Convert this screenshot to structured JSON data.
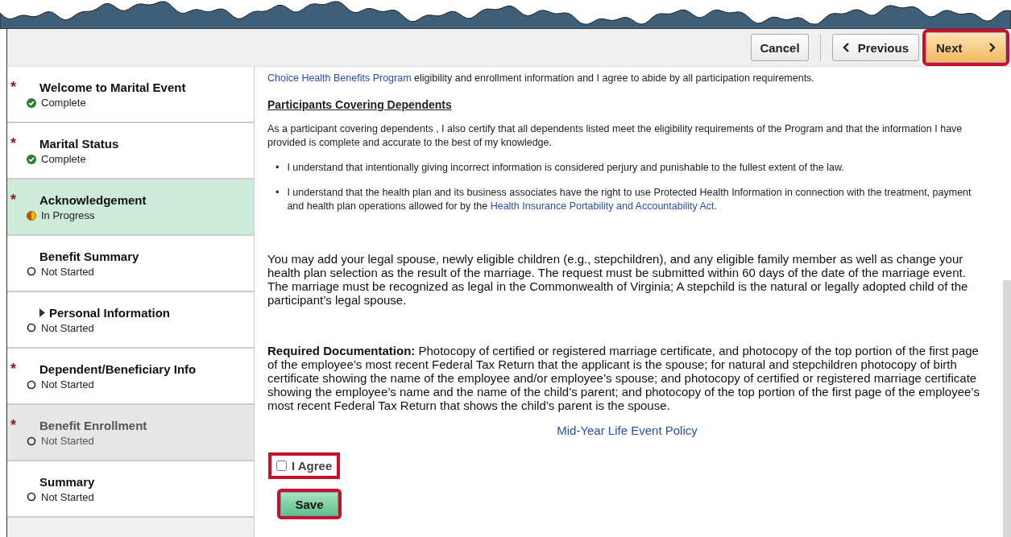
{
  "toolbar": {
    "buttons": [
      {
        "label": "Cancel",
        "kind": "cancel",
        "highlighted": false
      },
      {
        "label": "Previous",
        "kind": "previous",
        "highlighted": false
      },
      {
        "label": "Next",
        "kind": "next",
        "highlighted": true
      }
    ]
  },
  "steps": [
    {
      "required_mark": "*",
      "title": "Welcome to Marital Event",
      "status": {
        "text": "Complete",
        "kind": "complete"
      },
      "kind": "step",
      "selected": false,
      "disabled": false
    },
    {
      "required_mark": "*",
      "title": "Marital Status",
      "status": {
        "text": "Complete",
        "kind": "complete"
      },
      "kind": "step",
      "selected": false,
      "disabled": false
    },
    {
      "required_mark": "*",
      "title": "Acknowledgement",
      "status": {
        "text": "In Progress",
        "kind": "in_progress"
      },
      "kind": "step",
      "selected": true,
      "disabled": false
    },
    {
      "title": "Benefit Summary",
      "status": {
        "text": "Not Started",
        "kind": "not_started"
      },
      "kind": "step",
      "selected": false,
      "disabled": false
    },
    {
      "title": "Personal Information",
      "status": {
        "text": "Not Started",
        "kind": "not_started"
      },
      "kind": "group",
      "selected": false,
      "disabled": false
    },
    {
      "required_mark": "*",
      "title": "Dependent/Beneficiary Info",
      "status": {
        "text": "Not Started",
        "kind": "not_started"
      },
      "kind": "step",
      "selected": false,
      "disabled": false
    },
    {
      "required_mark": "*",
      "title": "Benefit Enrollment",
      "status": {
        "text": "Not Started",
        "kind": "not_started"
      },
      "kind": "step",
      "selected": false,
      "disabled": true
    },
    {
      "title": "Summary",
      "status": {
        "text": "Not Started",
        "kind": "not_started"
      },
      "kind": "step",
      "selected": false,
      "disabled": false
    }
  ],
  "content": {
    "intro": [
      {
        "kind": "link",
        "text": "Choice Health Benefits Program"
      },
      {
        "kind": "text",
        "text": " eligibility and enrollment information and I agree to abide by all participation requirements."
      }
    ],
    "heading": "Participants Covering Dependents",
    "certify": "As a participant covering dependents , I also certify that all dependents listed meet the eligibility requirements of the Program and that the information I have provided is complete and accurate to the best of my knowledge.",
    "bullets": [
      {
        "marker": "•",
        "parts": [
          {
            "kind": "text",
            "text": "I understand that intentionally giving incorrect information is considered perjury and punishable to the fullest extent of the law."
          }
        ]
      },
      {
        "marker": "•",
        "parts": [
          {
            "kind": "text",
            "text": "I understand that the health plan and its business associates have the right to use Protected Health Information in connection with the treatment, payment and health plan operations allowed for by the "
          },
          {
            "kind": "link",
            "text": "Health Insurance Portability and Accountability Act."
          }
        ]
      }
    ],
    "spouse_note": "You may add your legal spouse, newly eligible children (e.g., stepchildren), and any eligible family member as well as change your health plan selection as the result of the marriage.   The request must be submitted within 60 days of the date of the marriage event. The marriage must be recognized as legal in the Commonwealth of Virginia; A stepchild is the natural or legally adopted child of the participant’s legal spouse.",
    "documentation": "**Required Documentation:** Photocopy of certified or registered marriage certificate, and photocopy of the top portion of the first page of the employee’s most recent Federal Tax Return that the applicant is the spouse;  for natural and stepchildren photocopy of birth certificate showing the name of the employee and/or employee’s spouse; and photocopy of certified or registered marriage certificate showing the employee’s name and the name of the child’s parent; and photocopy of the top portion of the first page of the employee’s most recent Federal Tax Return that shows the child’s parent is the spouse.",
    "policy_link": "Mid-Year Life Event Policy",
    "agree": {
      "label": "I Agree",
      "checked": false,
      "highlighted": true
    },
    "save": {
      "label": "Save",
      "highlighted": true
    }
  }
}
